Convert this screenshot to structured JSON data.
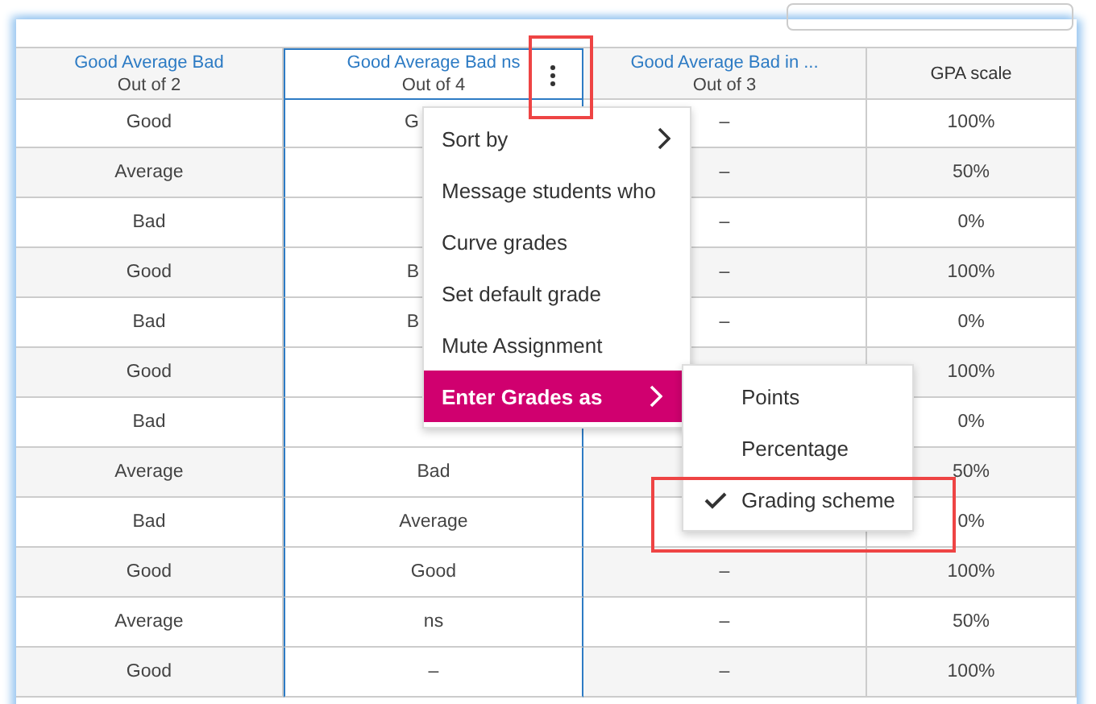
{
  "table": {
    "columns": [
      {
        "kind": "assignment",
        "title": "Good Average Bad",
        "subtitle": "Out of 2",
        "selected": false
      },
      {
        "kind": "assignment",
        "title": "Good Average Bad ns",
        "subtitle": "Out of 4",
        "selected": true
      },
      {
        "kind": "assignment",
        "title": "Good Average Bad in ...",
        "subtitle": "Out of 3",
        "selected": false
      },
      {
        "kind": "scale",
        "title": "GPA scale",
        "selected": false
      }
    ],
    "rows": [
      [
        "Good",
        {
          "text": "G",
          "covered": true
        },
        "–",
        "100%"
      ],
      [
        "Average",
        null,
        "–",
        "50%"
      ],
      [
        "Bad",
        null,
        "–",
        "0%"
      ],
      [
        "Good",
        {
          "text": "B",
          "covered": true
        },
        "–",
        "100%"
      ],
      [
        "Bad",
        {
          "text": "B",
          "covered": true
        },
        "–",
        "0%"
      ],
      [
        "Good",
        null,
        null,
        "100%"
      ],
      [
        "Bad",
        null,
        null,
        "0%"
      ],
      [
        "Average",
        "Bad",
        null,
        "50%"
      ],
      [
        "Bad",
        "Average",
        null,
        "0%"
      ],
      [
        "Good",
        "Good",
        "–",
        "100%"
      ],
      [
        "Average",
        "ns",
        "–",
        "50%"
      ],
      [
        "Good",
        "–",
        "–",
        "100%"
      ]
    ]
  },
  "column_menu": {
    "items": [
      {
        "label": "Sort by",
        "submenu": true,
        "highlighted": false
      },
      {
        "label": "Message students who",
        "submenu": false,
        "highlighted": false
      },
      {
        "label": "Curve grades",
        "submenu": false,
        "highlighted": false
      },
      {
        "label": "Set default grade",
        "submenu": false,
        "highlighted": false
      },
      {
        "label": "Mute Assignment",
        "submenu": false,
        "highlighted": false
      },
      {
        "label": "Enter Grades as",
        "submenu": true,
        "highlighted": true
      }
    ],
    "submenu": [
      {
        "label": "Points",
        "checked": false
      },
      {
        "label": "Percentage",
        "checked": false
      },
      {
        "label": "Grading scheme",
        "checked": true
      }
    ]
  }
}
